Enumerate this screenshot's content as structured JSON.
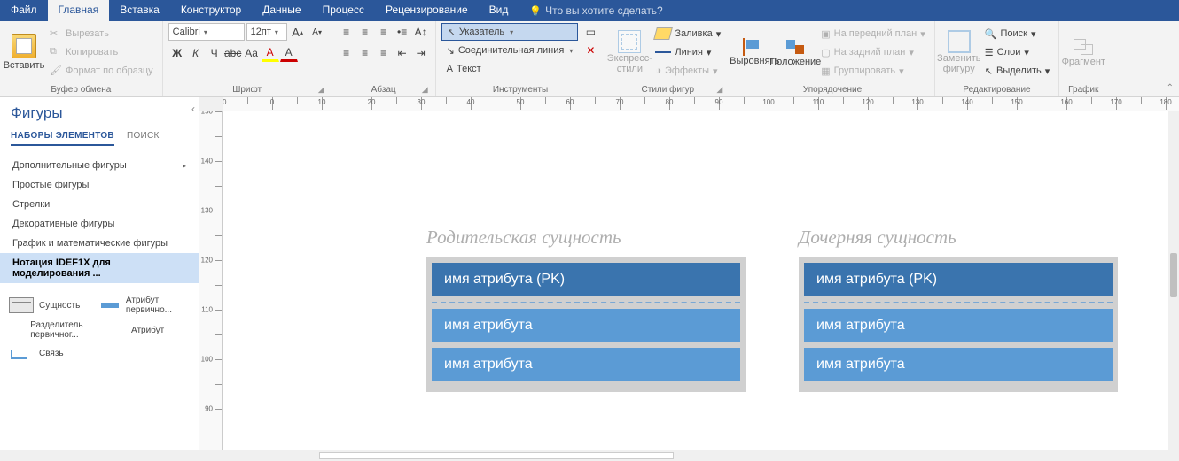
{
  "tabs": {
    "file": "Файл",
    "home": "Главная",
    "insert": "Вставка",
    "design": "Конструктор",
    "data": "Данные",
    "process": "Процесс",
    "review": "Рецензирование",
    "view": "Вид",
    "help": "Что вы хотите сделать?"
  },
  "clipboard": {
    "paste": "Вставить",
    "cut": "Вырезать",
    "copy": "Копировать",
    "painter": "Формат по образцу",
    "label": "Буфер обмена"
  },
  "font": {
    "name": "Calibri",
    "size": "12пт",
    "label": "Шрифт",
    "bold": "Ж",
    "italic": "К",
    "underline": "Ч",
    "strike": "abc",
    "case": "Aa",
    "grow": "A",
    "shrink": "A",
    "color": "A"
  },
  "paragraph": {
    "label": "Абзац"
  },
  "tools": {
    "pointer": "Указатель",
    "connector": "Соединительная линия",
    "text": "Текст",
    "label": "Инструменты"
  },
  "shapeStyles": {
    "styles": "Экспресс-стили",
    "fill": "Заливка",
    "line": "Линия",
    "effects": "Эффекты",
    "label": "Стили фигур"
  },
  "arrange": {
    "align": "Выровнять",
    "position": "Положение",
    "front": "На передний план",
    "back": "На задний план",
    "group": "Группировать",
    "label": "Упорядочение"
  },
  "edit": {
    "change": "Заменить фигуру",
    "find": "Поиск",
    "layers": "Слои",
    "select": "Выделить",
    "label": "Редактирование"
  },
  "chartGroup": {
    "fragment": "Фрагмент",
    "label": "График"
  },
  "shapesPane": {
    "title": "Фигуры",
    "tabSets": "НАБОРЫ ЭЛЕМЕНТОВ",
    "tabSearch": "ПОИСК",
    "cats": {
      "more": "Дополнительные фигуры",
      "simple": "Простые фигуры",
      "arrows": "Стрелки",
      "deco": "Декоративные фигуры",
      "math": "График и математические фигуры",
      "idef": "Нотация IDEF1X для моделирования ..."
    },
    "items": {
      "entity": "Сущность",
      "pkattr": "Атрибут первично...",
      "sep": "Разделитель первичног...",
      "attr": "Атрибут",
      "link": "Связь"
    }
  },
  "canvas": {
    "parentTitle": "Родительская сущность",
    "childTitle": "Дочерняя сущность",
    "pk": "имя атрибута  (PK)",
    "attr": "имя атрибута"
  }
}
